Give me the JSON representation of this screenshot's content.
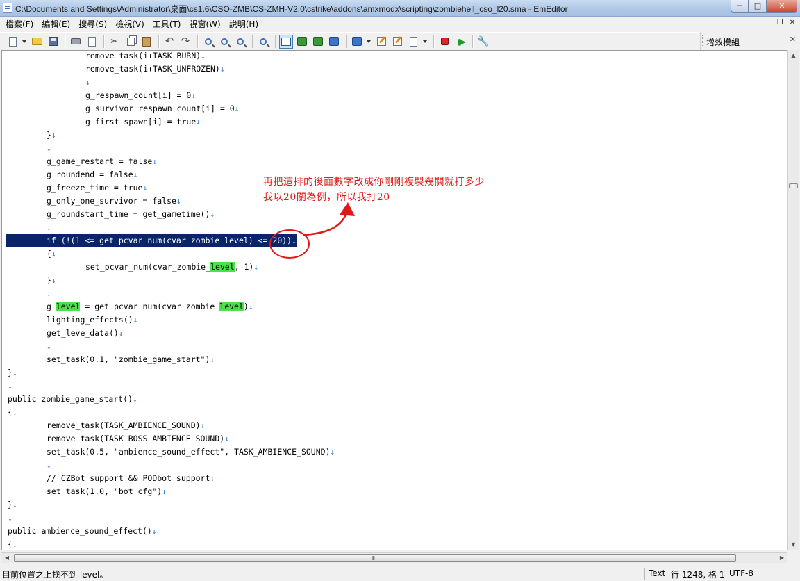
{
  "window": {
    "title": "C:\\Documents and Settings\\Administrator\\桌面\\cs1.6\\CSO-ZMB\\CS-ZMH-V2.0\\cstrike\\addons\\amxmodx\\scripting\\zombiehell_cso_l20.sma - EmEditor",
    "min_label": "─",
    "max_label": "□",
    "close_label": "✕"
  },
  "menu": {
    "items": [
      "檔案(F)",
      "編輯(E)",
      "搜尋(S)",
      "檢視(V)",
      "工具(T)",
      "視窗(W)",
      "說明(H)"
    ],
    "mdi_min": "─",
    "mdi_restore": "❐",
    "mdi_close": "✕"
  },
  "plugins_panel": {
    "title": "增效模組",
    "close_label": "✕"
  },
  "editor": {
    "lines": [
      {
        "indent": 2,
        "text": "remove_task(i+TASK_BURN)"
      },
      {
        "indent": 2,
        "text": "remove_task(i+TASK_UNFROZEN)"
      },
      {
        "indent": 2,
        "text": ""
      },
      {
        "indent": 2,
        "text": "g_respawn_count[i] = 0"
      },
      {
        "indent": 2,
        "text": "g_survivor_respawn_count[i] = 0"
      },
      {
        "indent": 2,
        "text": "g_first_spawn[i] = true"
      },
      {
        "indent": 1,
        "text": "}"
      },
      {
        "indent": 1,
        "text": ""
      },
      {
        "indent": 1,
        "text": "g_game_restart = false"
      },
      {
        "indent": 1,
        "text": "g_roundend = false"
      },
      {
        "indent": 1,
        "text": "g_freeze_time = true"
      },
      {
        "indent": 1,
        "text": "g_only_one_survivor = false"
      },
      {
        "indent": 1,
        "text": "g_roundstart_time = get_gametime()"
      },
      {
        "indent": 1,
        "text": ""
      },
      {
        "indent": 1,
        "text": "if (!(1 <= get_pcvar_num(cvar_zombie_level) <= 20))",
        "selected": true
      },
      {
        "indent": 1,
        "text": "{"
      },
      {
        "indent": 2,
        "text": "set_pcvar_num(cvar_zombie_",
        "hl": "level",
        "post": ", 1)"
      },
      {
        "indent": 1,
        "text": "}"
      },
      {
        "indent": 1,
        "text": ""
      },
      {
        "indent": 1,
        "text": "g_",
        "hl": "level",
        "post": " = get_pcvar_num(cvar_zombie_",
        "hl2": "level",
        "post2": ")"
      },
      {
        "indent": 1,
        "text": "lighting_effects()"
      },
      {
        "indent": 1,
        "text": "get_leve_data()"
      },
      {
        "indent": 1,
        "text": ""
      },
      {
        "indent": 1,
        "text": "set_task(0.1, \"zombie_game_start\")"
      },
      {
        "indent": 0,
        "text": "}"
      },
      {
        "indent": 0,
        "text": ""
      },
      {
        "indent": 0,
        "text": "public zombie_game_start()"
      },
      {
        "indent": 0,
        "text": "{"
      },
      {
        "indent": 1,
        "text": "remove_task(TASK_AMBIENCE_SOUND)"
      },
      {
        "indent": 1,
        "text": "remove_task(TASK_BOSS_AMBIENCE_SOUND)"
      },
      {
        "indent": 1,
        "text": "set_task(0.5, \"ambience_sound_effect\", TASK_AMBIENCE_SOUND)"
      },
      {
        "indent": 1,
        "text": ""
      },
      {
        "indent": 1,
        "text": "// CZBot support && PODbot support"
      },
      {
        "indent": 1,
        "text": "set_task(1.0, \"bot_cfg\")"
      },
      {
        "indent": 0,
        "text": "}"
      },
      {
        "indent": 0,
        "text": ""
      },
      {
        "indent": 0,
        "text": "public ambience_sound_effect()"
      },
      {
        "indent": 0,
        "text": "{"
      }
    ],
    "eol_mark": "↓"
  },
  "annotation": {
    "line1": "再把這排的後面數字改成你剛剛複製幾關就打多少",
    "line2": "我以20關為例，所以我打20",
    "color": "#e01818"
  },
  "scrollbars": {
    "up": "▲",
    "down": "▼",
    "left": "◀",
    "right": "▶",
    "grip": "III"
  },
  "status": {
    "message": "目前位置之上找不到 level。",
    "mode": "Text",
    "position": "行 1248, 格 1",
    "encoding": "UTF-8"
  },
  "colors": {
    "selection": "#0a246a",
    "match_highlight": "#4fe04f",
    "eol_mark": "#2a7ad0"
  }
}
